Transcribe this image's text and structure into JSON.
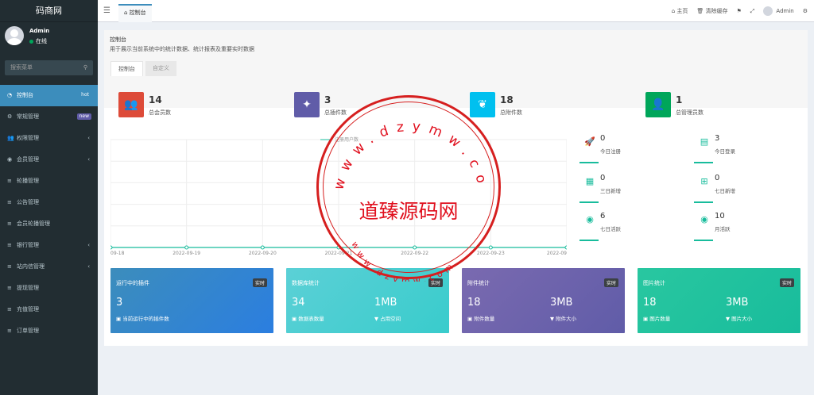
{
  "app": {
    "logo": "码商网"
  },
  "user": {
    "name": "Admin",
    "status": "在线"
  },
  "search": {
    "placeholder": "搜索菜单",
    "icon": "search-icon"
  },
  "sidebar": {
    "items": [
      {
        "label": "控制台",
        "icon": "dashboard-icon",
        "badge": "hot",
        "active": true
      },
      {
        "label": "常规管理",
        "icon": "cogs-icon",
        "badge": "new"
      },
      {
        "label": "权限管理",
        "icon": "users-icon",
        "arrow": "‹"
      },
      {
        "label": "会员管理",
        "icon": "user-circle-icon",
        "arrow": "‹"
      },
      {
        "label": "轮播管理",
        "icon": "list-icon"
      },
      {
        "label": "公告管理",
        "icon": "list-icon"
      },
      {
        "label": "会员轮播管理",
        "icon": "list-icon"
      },
      {
        "label": "银行管理",
        "icon": "list-icon",
        "arrow": "‹"
      },
      {
        "label": "站内信管理",
        "icon": "list-icon",
        "arrow": "‹"
      },
      {
        "label": "提现管理",
        "icon": "list-icon"
      },
      {
        "label": "充值管理",
        "icon": "list-icon"
      },
      {
        "label": "订单管理",
        "icon": "list-icon"
      }
    ]
  },
  "topbar": {
    "tab": "控制台",
    "home": "主页",
    "clear_cache": "清除缓存",
    "admin": "Admin"
  },
  "page": {
    "title": "控制台",
    "subtitle": "用于展示当前系统中的统计数据、统计报表及重要实时数据",
    "tabs": [
      "控制台",
      "自定义"
    ]
  },
  "stats": [
    {
      "value": "14",
      "label": "总会员数",
      "color": "#dd4b39",
      "icon": "users-icon"
    },
    {
      "value": "3",
      "label": "总插件数",
      "color": "#605ca8",
      "icon": "magic-wand-icon"
    },
    {
      "value": "18",
      "label": "总附件数",
      "color": "#00c0ef",
      "icon": "leaf-icon"
    },
    {
      "value": "1",
      "label": "总管理员数",
      "color": "#00a65a",
      "icon": "user-icon"
    }
  ],
  "chart_data": {
    "type": "line",
    "legend": "注册用户数",
    "categories": [
      "09-18",
      "2022-09-19",
      "2022-09-20",
      "2022-09-21",
      "2022-09-22",
      "2022-09-23",
      "2022-09"
    ],
    "series": [
      {
        "name": "注册用户数",
        "values": [
          0,
          0,
          0,
          0,
          0,
          0,
          0
        ]
      }
    ],
    "color": "#18bc9c"
  },
  "minis": [
    {
      "value": "0",
      "label": "今日注册",
      "icon": "rocket-icon"
    },
    {
      "value": "3",
      "label": "今日登录",
      "icon": "id-card-icon"
    },
    {
      "value": "0",
      "label": "三日新增",
      "icon": "calendar-icon"
    },
    {
      "value": "0",
      "label": "七日新增",
      "icon": "calendar-plus-icon"
    },
    {
      "value": "6",
      "label": "七日活跃",
      "icon": "user-circle-icon"
    },
    {
      "value": "10",
      "label": "月活跃",
      "icon": "user-circle-icon"
    }
  ],
  "cards": [
    {
      "title": "运行中的插件",
      "tag": "实时",
      "v1": "3",
      "v2": "",
      "f1": "当前运行中的插件数",
      "f2": "",
      "color": "#3c8dbc"
    },
    {
      "title": "数据库统计",
      "tag": "实时",
      "v1": "34",
      "v2": "1MB",
      "f1": "数据表数量",
      "f2": "占用空间",
      "color": "#39cccc"
    },
    {
      "title": "附件统计",
      "tag": "实时",
      "v1": "18",
      "v2": "3MB",
      "f1": "附件数量",
      "f2": "附件大小",
      "color": "#605ca8"
    },
    {
      "title": "图片统计",
      "tag": "实时",
      "v1": "18",
      "v2": "3MB",
      "f1": "图片数量",
      "f2": "图片大小",
      "color": "#18bc9c"
    }
  ],
  "stamp": {
    "center": "道臻源码网",
    "top": "www.dzymw.com",
    "bottom": "www.dzymw.com"
  }
}
